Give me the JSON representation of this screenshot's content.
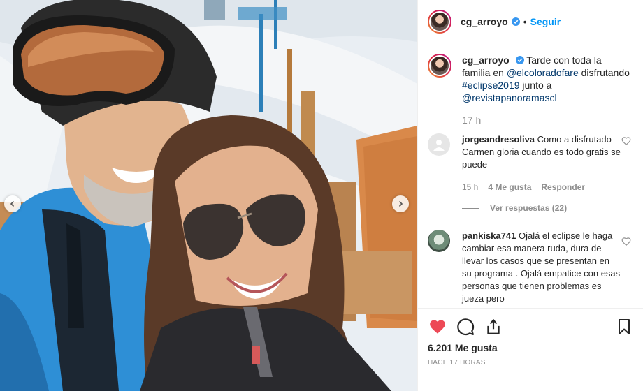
{
  "header": {
    "username": "cg_arroyo",
    "separator": "•",
    "follow_label": "Seguir"
  },
  "caption": {
    "username": "cg_arroyo",
    "text_1": "Tarde con toda la familia en",
    "mention_1": "@elcoloradofare",
    "text_2": "disfrutando",
    "hashtag": "#eclipse2019",
    "text_3": "junto a",
    "mention_2": "@revistapanoramascl",
    "time": "17 h"
  },
  "comments": [
    {
      "username": "jorgeandresoliva",
      "text": "Como a disfrutado Carmen gloria cuando es todo gratis se puede",
      "time": "15 h",
      "likes": "4 Me gusta",
      "reply_label": "Responder",
      "view_replies": "Ver respuestas (22)"
    },
    {
      "username": "pankiska741",
      "text": "Ojalá el eclipse le haga cambiar esa manera ruda, dura de llevar los casos que se presentan en su programa . Ojalá empatice con esas personas que tienen problemas es jueza pero"
    }
  ],
  "actions": {
    "likes": "6.201 Me gusta",
    "posted": "HACE 17 HORAS"
  },
  "colors": {
    "like_red": "#ed4956",
    "link_blue": "#00376b",
    "follow_blue": "#0095f6",
    "verified_blue": "#3897f0"
  },
  "icons": [
    "chevron-left-icon",
    "chevron-right-icon",
    "verified-icon",
    "heart-icon",
    "comment-icon",
    "share-icon",
    "bookmark-icon",
    "user-placeholder-icon"
  ]
}
